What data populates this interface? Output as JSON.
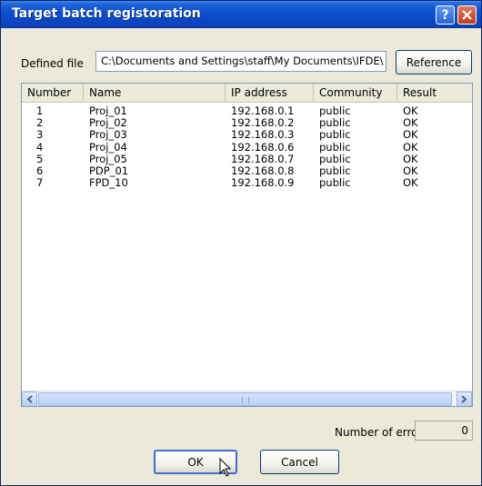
{
  "window": {
    "title": "Target batch registoration"
  },
  "defined_file": {
    "label": "Defined file",
    "path": "C:\\Documents and Settings\\staff\\My Documents\\IFDE\\",
    "reference_button": "Reference"
  },
  "list": {
    "columns": [
      "Number",
      "Name",
      "IP address",
      "Community",
      "Result"
    ],
    "rows": [
      {
        "number": "1",
        "name": "Proj_01",
        "ip": "192.168.0.1",
        "community": "public",
        "result": "OK"
      },
      {
        "number": "2",
        "name": "Proj_02",
        "ip": "192.168.0.2",
        "community": "public",
        "result": "OK"
      },
      {
        "number": "3",
        "name": "Proj_03",
        "ip": "192.168.0.3",
        "community": "public",
        "result": "OK"
      },
      {
        "number": "4",
        "name": "Proj_04",
        "ip": "192.168.0.6",
        "community": "public",
        "result": "OK"
      },
      {
        "number": "5",
        "name": "Proj_05",
        "ip": "192.168.0.7",
        "community": "public",
        "result": "OK"
      },
      {
        "number": "6",
        "name": "PDP_01",
        "ip": "192.168.0.8",
        "community": "public",
        "result": "OK"
      },
      {
        "number": "7",
        "name": "FPD_10",
        "ip": "192.168.0.9",
        "community": "public",
        "result": "OK"
      }
    ]
  },
  "errors": {
    "label": "Number of error",
    "count": "0"
  },
  "buttons": {
    "ok": "OK",
    "cancel": "Cancel"
  },
  "icons": {
    "help": "help-icon",
    "close": "close-icon",
    "scroll_left": "chevron-left-icon",
    "scroll_right": "chevron-right-icon",
    "cursor": "mouse-pointer-icon"
  },
  "colors": {
    "titlebar": "#0b4fd0",
    "dialog_bg": "#ece9d8",
    "close_button": "#c33a16"
  }
}
